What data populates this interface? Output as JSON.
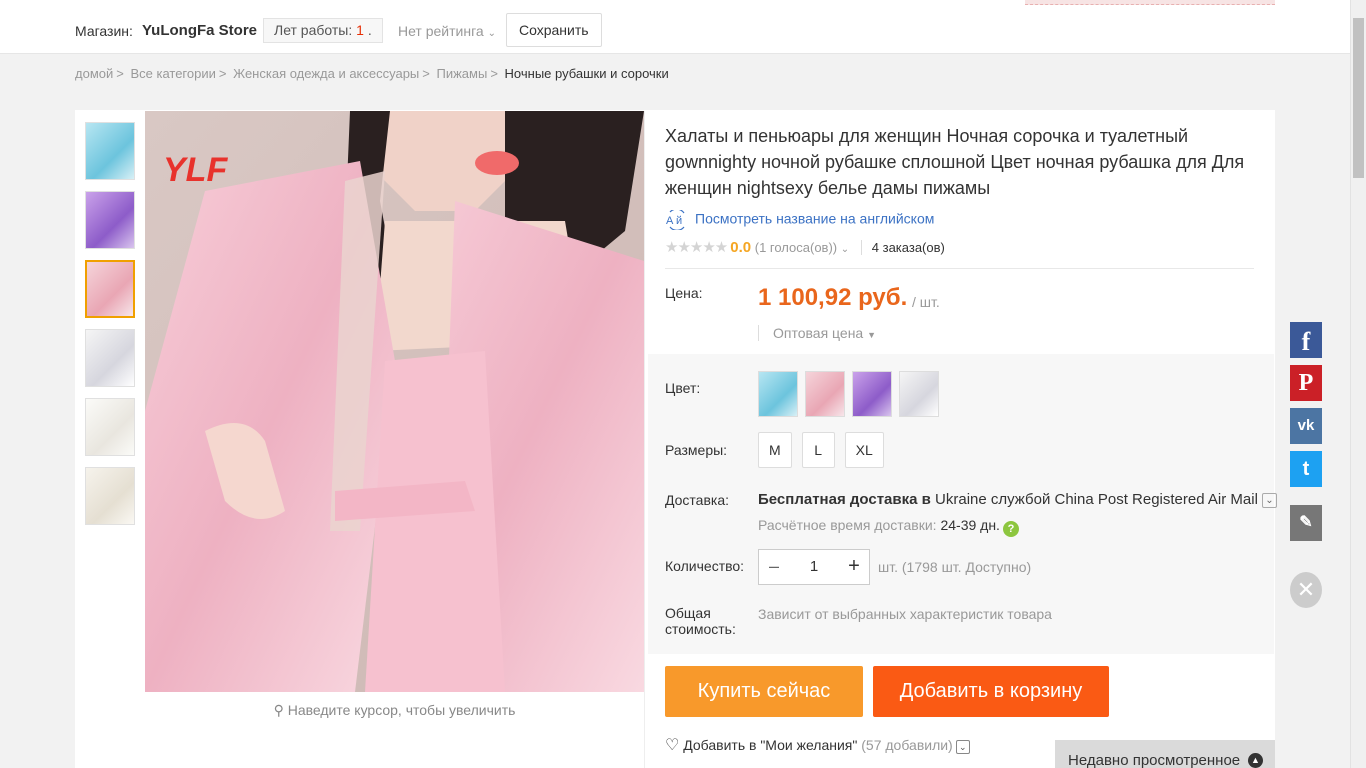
{
  "store": {
    "label": "Магазин:",
    "name": "YuLongFa Store",
    "years_label": "Лет работы:",
    "years_value": "1",
    "years_suffix": ".",
    "rating_label": "Нет рейтинга",
    "save_label": "Сохранить"
  },
  "breadcrumb": [
    "домой",
    "Все категории",
    "Женская одежда и аксессуары",
    "Пижамы",
    "Ночные рубашки и сорочки"
  ],
  "breadcrumb_sep": ">",
  "gallery": {
    "thumb_count": 6,
    "active_thumb_index": 2,
    "watermark": "YLF",
    "zoom_hint": "Наведите курсор, чтобы увеличить"
  },
  "product": {
    "title": "Халаты и пеньюары для женщин Ночная сорочка и туалетный gownnighty ночной рубашке сплошной Цвет ночная рубашка для Для женщин nightsexy белье дамы пижамы",
    "translate_link": "Посмотреть название на английском",
    "stars": "★★★★★",
    "rating_score": "0.0",
    "votes": "(1 голоса(ов))",
    "orders": "4 заказа(ов)"
  },
  "price": {
    "label": "Цена:",
    "value": "1 100,92 руб.",
    "unit": "/ шт.",
    "wholesale": "Оптовая цена"
  },
  "color": {
    "label": "Цвет:"
  },
  "sizes": {
    "label": "Размеры:",
    "options": [
      "M",
      "L",
      "XL"
    ]
  },
  "shipping": {
    "label": "Доставка:",
    "free": "Бесплатная доставка в",
    "destination": "Ukraine",
    "carrier_prefix": "службой",
    "carrier": "China Post Registered Air Mail",
    "eta_label": "Расчётное время доставки:",
    "eta_value": "24-39 дн."
  },
  "quantity": {
    "label": "Количество:",
    "value": "1",
    "available": "шт. (1798 шт. Доступно)"
  },
  "total": {
    "label_line1": "Общая",
    "label_line2": "стоимость:",
    "value": "Зависит от выбранных характеристик товара"
  },
  "buttons": {
    "buy_now": "Купить сейчас",
    "add_to_cart": "Добавить в корзину"
  },
  "wishlist": {
    "label": "Добавить в \"Мои желания\"",
    "count": "(57 добавили)"
  },
  "recent": {
    "label": "Недавно просмотренное"
  },
  "social": {
    "facebook": "f",
    "pinterest": "P",
    "vk": "vk",
    "twitter": "t"
  },
  "colors": {
    "price": "#e9661c",
    "buy_button": "#f8992b",
    "cart_button": "#fa5a14",
    "link": "#3c72c4",
    "facebook": "#3b5998",
    "pinterest": "#cb2027",
    "vk": "#4c75a3",
    "twitter": "#1da1f2"
  }
}
